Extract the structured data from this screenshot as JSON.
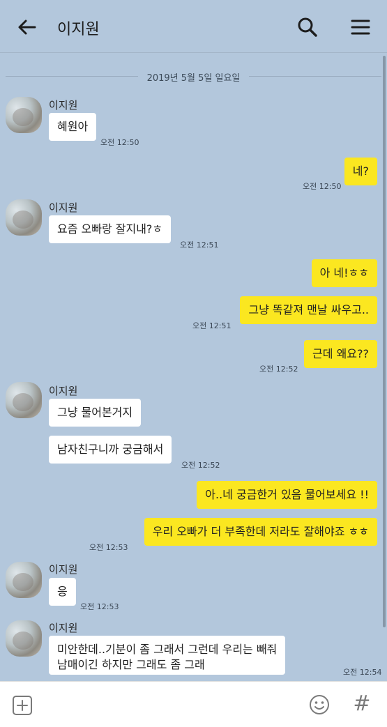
{
  "header": {
    "title": "이지원"
  },
  "date_separator": "2019년 5월 5일 일요일",
  "messages": [
    {
      "sender": "이지원",
      "text": "혜원아",
      "time": "오전 12:50"
    },
    {
      "text": "네?",
      "time": "오전 12:50"
    },
    {
      "sender": "이지원",
      "text": "요즘 오빠랑 잘지내?ㅎ",
      "time": "오전 12:51"
    },
    {
      "text": "아 네!ㅎㅎ"
    },
    {
      "text": "그냥 똑같져 맨날 싸우고..",
      "time": "오전 12:51"
    },
    {
      "text": "근데 왜요??",
      "time": "오전 12:52"
    },
    {
      "sender": "이지원",
      "text": "그냥 물어본거지"
    },
    {
      "text": "남자친구니까 궁금해서",
      "time": "오전 12:52"
    },
    {
      "text": "아..네 궁금한거 있음 물어보세요 !!"
    },
    {
      "text": "우리 오빠가 더 부족한데 저라도 잘해야죠 ㅎㅎ",
      "time": "오전 12:53"
    },
    {
      "sender": "이지원",
      "text": "응",
      "time": "오전 12:53"
    },
    {
      "sender": "이지원",
      "text_line1": "미안한데..기분이 좀 그래서 그런데 우리는 빼줘",
      "text_line2": "남매이긴 하지만 그래도 좀 그래",
      "time": "오전 12:54"
    }
  ],
  "input": {
    "placeholder": "",
    "hash_symbol": "#"
  },
  "colors": {
    "background": "#b3c7dc",
    "my_bubble": "#fbe720",
    "their_bubble": "#ffffff"
  }
}
